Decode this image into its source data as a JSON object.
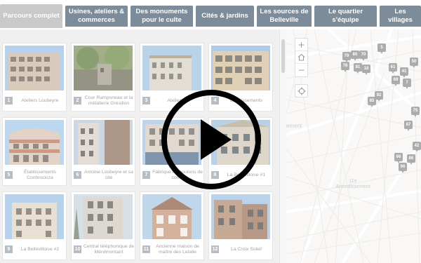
{
  "tabs": [
    {
      "label": "Parcours complet",
      "active": true
    },
    {
      "label": "Usines, ateliers & commerces"
    },
    {
      "label": "Des monuments pour le culte"
    },
    {
      "label": "Cités & jardins"
    },
    {
      "label": "Les sources de Belleville"
    },
    {
      "label": "Le quartier s'équipe"
    },
    {
      "label": "Les villages"
    }
  ],
  "gallery": {
    "items": [
      {
        "num": "1",
        "caption": "Ateliers Loubeyre"
      },
      {
        "num": "2",
        "caption": "Cour Ramponeau et la métallerie Grésillon"
      },
      {
        "num": "3",
        "caption": "Ateliers B"
      },
      {
        "num": "4",
        "caption": "Établissements"
      },
      {
        "num": "5",
        "caption": "Établissements Continsouza"
      },
      {
        "num": "6",
        "caption": "Antoine Loubeyre et sa cité"
      },
      {
        "num": "7",
        "caption": "Fabrique de boutons de corne"
      },
      {
        "num": "8",
        "caption": "La Bellevilloise #1"
      },
      {
        "num": "9",
        "caption": "La Bellevilloise #2"
      },
      {
        "num": "10",
        "caption": "Central téléphonique de Ménilmontant"
      },
      {
        "num": "11",
        "caption": "Ancienne maison de maître des Letalle"
      },
      {
        "num": "12",
        "caption": "La Croix Soleil"
      }
    ]
  },
  "map": {
    "zoom_in": "+",
    "zoom_out": "−",
    "labels": {
      "district": "11e\nArrondissement",
      "partial": "ement"
    },
    "markers": [
      "5",
      "79",
      "80",
      "70",
      "78",
      "81",
      "18",
      "50",
      "61",
      "41",
      "92",
      "85",
      "69",
      "7",
      "86",
      "75",
      "87",
      "66",
      "96",
      "42"
    ]
  },
  "video": {
    "play_icon": "play-icon"
  }
}
